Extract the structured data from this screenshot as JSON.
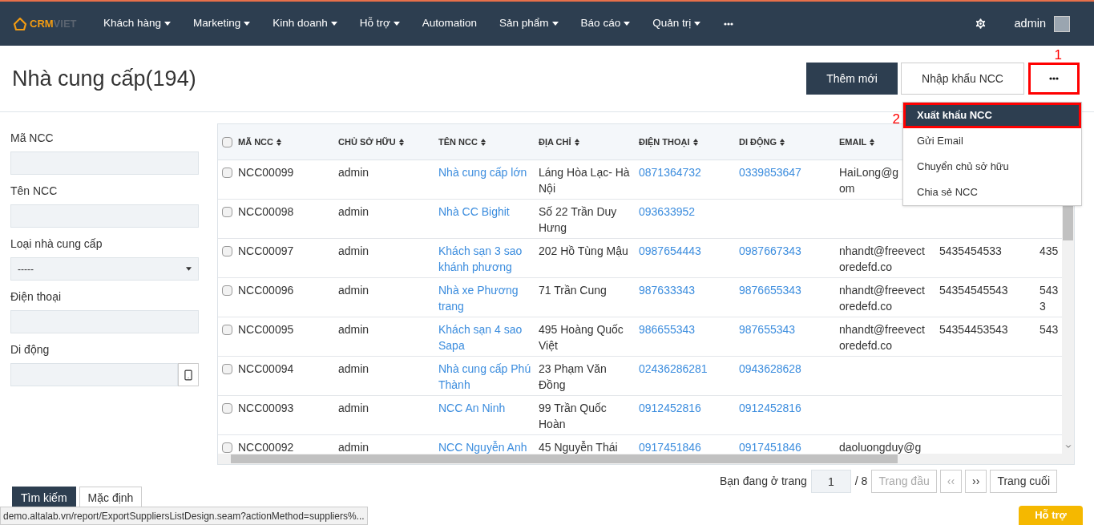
{
  "navbar": {
    "logo": {
      "part1": "CRM",
      "part2": "VIET"
    },
    "items": [
      {
        "label": "Khách hàng",
        "has_menu": true
      },
      {
        "label": "Marketing",
        "has_menu": true
      },
      {
        "label": "Kinh doanh",
        "has_menu": true
      },
      {
        "label": "Hỗ trợ",
        "has_menu": true
      },
      {
        "label": "Automation",
        "has_menu": false
      },
      {
        "label": "Sản phẩm",
        "has_menu": true
      },
      {
        "label": "Báo cáo",
        "has_menu": true
      },
      {
        "label": "Quản trị",
        "has_menu": true
      }
    ],
    "user": "admin"
  },
  "page": {
    "title": "Nhà cung cấp(194)",
    "buttons": [
      {
        "label": "Thêm mới",
        "primary": true
      },
      {
        "label": "Nhập khẩu NCC",
        "primary": false
      }
    ]
  },
  "more_menu": {
    "expanded": true,
    "items": [
      {
        "label": "Xuất khẩu NCC",
        "selected": true
      },
      {
        "label": "Gửi Email",
        "selected": false
      },
      {
        "label": "Chuyển chủ sở hữu",
        "selected": false
      },
      {
        "label": "Chia sẻ NCC",
        "selected": false
      }
    ]
  },
  "annotations": [
    {
      "label": "1"
    },
    {
      "label": "2"
    }
  ],
  "filters": [
    {
      "label": "Mã NCC",
      "kind": "text"
    },
    {
      "label": "Tên NCC",
      "kind": "text"
    },
    {
      "label": "Loại nhà cung cấp",
      "kind": "select",
      "value": "-----"
    },
    {
      "label": "Điện thoại",
      "kind": "text"
    },
    {
      "label": "Di động",
      "kind": "phone"
    }
  ],
  "filter_buttons": [
    {
      "label": "Tìm kiếm",
      "primary": true
    },
    {
      "label": "Mặc định",
      "primary": false
    }
  ],
  "table": {
    "columns": [
      {
        "label": "MÃ NCC",
        "link": false
      },
      {
        "label": "CHỦ SỞ HỮU",
        "link": false
      },
      {
        "label": "TÊN NCC",
        "link": true
      },
      {
        "label": "ĐỊA CHỈ",
        "link": false
      },
      {
        "label": "ĐIỆN THOẠI",
        "link": true
      },
      {
        "label": "DI ĐỘNG",
        "link": true
      },
      {
        "label": "EMAIL",
        "link": false
      },
      {
        "link": false
      },
      {
        "link": false
      }
    ],
    "all_checked": false,
    "rows": [
      {
        "checked": false,
        "cells": [
          "NCC00099",
          "admin",
          "Nhà cung cấp lớn",
          "Láng Hòa Lạc- Hà Nội",
          "0871364732",
          "0339853647",
          "HaiLong@g\nom",
          "",
          ""
        ]
      },
      {
        "checked": false,
        "cells": [
          "NCC00098",
          "admin",
          "Nhà CC Bighit",
          "Số 22 Trần Duy Hưng",
          "093633952",
          "",
          "",
          "",
          ""
        ]
      },
      {
        "checked": false,
        "cells": [
          "NCC00097",
          "admin",
          "Khách sạn 3 sao khánh phương",
          "202 Hồ Tùng Mậu",
          "0987654443",
          "0987667343",
          "nhandt@freevect\noredefd.co",
          "5435454533",
          "435"
        ]
      },
      {
        "checked": false,
        "cells": [
          "NCC00096",
          "admin",
          "Nhà xe Phương trang",
          "71 Trần Cung",
          "987633343",
          "9876655343",
          "nhandt@freevect\noredefd.co",
          "54354545543",
          "543\n3"
        ]
      },
      {
        "checked": false,
        "cells": [
          "NCC00095",
          "admin",
          "Khách sạn 4 sao Sapa",
          "495 Hoàng Quốc Việt",
          "986655343",
          "987655343",
          "nhandt@freevect\noredefd.co",
          "54354453543",
          "543"
        ]
      },
      {
        "checked": false,
        "cells": [
          "NCC00094",
          "admin",
          "Nhà cung cấp Phú Thành",
          "23 Phạm Văn Đồng",
          "02436286281",
          "0943628628",
          "",
          "",
          ""
        ]
      },
      {
        "checked": false,
        "cells": [
          "NCC00093",
          "admin",
          "NCC An Ninh",
          "99 Trần Quốc Hoàn",
          "0912452816",
          "0912452816",
          "",
          "",
          ""
        ]
      },
      {
        "checked": false,
        "cells": [
          "NCC00092",
          "admin",
          "NCC Nguyễn Anh",
          "45 Nguyễn Thái",
          "0917451846",
          "0917451846",
          "daoluongduy@g",
          "",
          ""
        ]
      }
    ]
  },
  "pagination": {
    "prefix": "Bạn đang ở trang",
    "page": "1",
    "total": "/ 8",
    "first": {
      "label": "Trang đầu",
      "disabled": true
    },
    "prev": {
      "label": "‹‹",
      "disabled": true
    },
    "next": {
      "label": "››",
      "disabled": false
    },
    "last": {
      "label": "Trang cuối",
      "disabled": false
    }
  },
  "status_url": "demo.altalab.vn/report/ExportSuppliersListDesign.seam?actionMethod=suppliers%...",
  "help_button": "Hỗ trợ"
}
